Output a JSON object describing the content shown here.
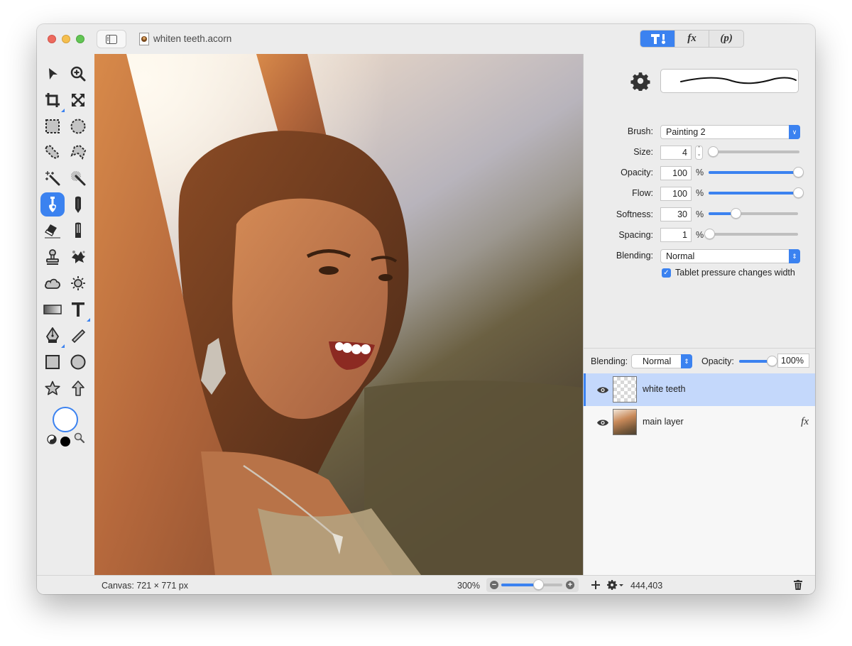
{
  "window": {
    "title": "whiten teeth.acorn"
  },
  "header": {
    "segments": [
      {
        "id": "tools",
        "label": "tools-icon",
        "active": true
      },
      {
        "id": "effects",
        "label": "fx",
        "active": false
      },
      {
        "id": "properties",
        "label": "(p)",
        "active": false
      }
    ]
  },
  "toolbox": {
    "tools": [
      {
        "name": "select-arrow"
      },
      {
        "name": "zoom"
      },
      {
        "name": "crop"
      },
      {
        "name": "transform"
      },
      {
        "name": "rect-select"
      },
      {
        "name": "ellipse-select"
      },
      {
        "name": "lasso"
      },
      {
        "name": "polygon-lasso"
      },
      {
        "name": "magic-wand"
      },
      {
        "name": "instant-alpha"
      },
      {
        "name": "brush",
        "active": true
      },
      {
        "name": "pencil"
      },
      {
        "name": "eraser"
      },
      {
        "name": "smudge"
      },
      {
        "name": "clone-stamp"
      },
      {
        "name": "burn-dodge"
      },
      {
        "name": "cloud"
      },
      {
        "name": "brightness"
      },
      {
        "name": "gradient"
      },
      {
        "name": "text"
      },
      {
        "name": "pen"
      },
      {
        "name": "line"
      },
      {
        "name": "rectangle"
      },
      {
        "name": "oval"
      },
      {
        "name": "star"
      },
      {
        "name": "arrow"
      }
    ],
    "colors": {
      "foreground": "#ffffff",
      "background": "#000000"
    }
  },
  "inspector": {
    "brush_label": "Brush:",
    "brush_value": "Painting 2",
    "size_label": "Size:",
    "size_value": "4",
    "opacity_label": "Opacity:",
    "opacity_value": "100",
    "flow_label": "Flow:",
    "flow_value": "100",
    "softness_label": "Softness:",
    "softness_value": "30",
    "spacing_label": "Spacing:",
    "spacing_value": "1",
    "percent": "%",
    "blending_label": "Blending:",
    "blending_value": "Normal",
    "tablet_label": "Tablet pressure changes width",
    "tablet_checked": true,
    "sliders": {
      "size": 0.02,
      "opacity": 1.0,
      "flow": 1.0,
      "softness": 0.3,
      "spacing": 0.01
    }
  },
  "layers": {
    "blending_label": "Blending:",
    "blending_value": "Normal",
    "opacity_label": "Opacity:",
    "opacity_value": "100%",
    "opacity_fraction": 1.0,
    "items": [
      {
        "name": "white teeth",
        "selected": true,
        "visible": true,
        "fx": false
      },
      {
        "name": "main layer",
        "selected": false,
        "visible": true,
        "fx": true,
        "fx_label": "fx"
      }
    ]
  },
  "status": {
    "canvas_info": "Canvas: 721 × 771 px",
    "zoom_level": "300%",
    "zoom_fraction": 0.6,
    "coordinates": "444,403"
  },
  "colors": {
    "accent": "#3b82f0",
    "selection": "#c4d8fb"
  }
}
